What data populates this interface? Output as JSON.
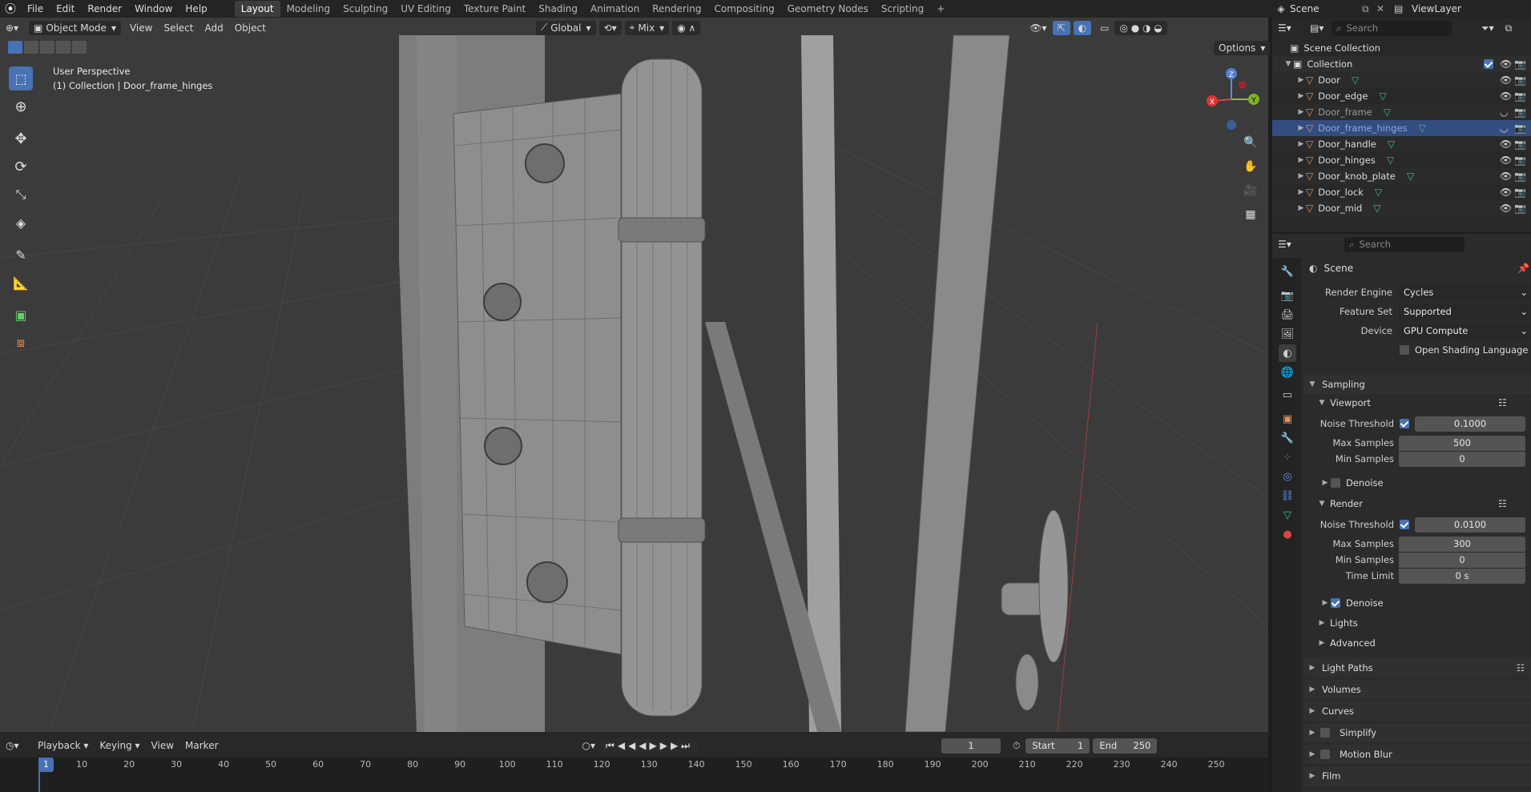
{
  "topbar": {
    "menus": [
      "File",
      "Edit",
      "Render",
      "Window",
      "Help"
    ],
    "workspaces": [
      "Layout",
      "Modeling",
      "Sculpting",
      "UV Editing",
      "Texture Paint",
      "Shading",
      "Animation",
      "Rendering",
      "Compositing",
      "Geometry Nodes",
      "Scripting"
    ],
    "active_workspace": "Layout",
    "add_tab": "+",
    "scene": "Scene",
    "view_layer": "ViewLayer"
  },
  "viewport": {
    "mode": "Object Mode",
    "menus": [
      "View",
      "Select",
      "Add",
      "Object"
    ],
    "orientation": "Global",
    "snap_mode": "Mix",
    "options": "Options",
    "info_line1": "User Perspective",
    "info_line2": "(1) Collection | Door_frame_hinges",
    "gizmo": {
      "x": "X",
      "y": "Y",
      "z": "Z"
    }
  },
  "timeline": {
    "menus": [
      "Playback",
      "Keying",
      "View",
      "Marker"
    ],
    "current_frame": "1",
    "start_label": "Start",
    "start": "1",
    "end_label": "End",
    "end": "250",
    "ruler": [
      "1",
      "10",
      "20",
      "30",
      "40",
      "50",
      "60",
      "70",
      "80",
      "90",
      "100",
      "110",
      "120",
      "130",
      "140",
      "150",
      "160",
      "170",
      "180",
      "190",
      "200",
      "210",
      "220",
      "230",
      "240",
      "250"
    ]
  },
  "outliner": {
    "search_placeholder": "Search",
    "scene_collection": "Scene Collection",
    "collection": "Collection",
    "objects": [
      "Door",
      "Door_edge",
      "Door_frame",
      "Door_frame_hinges",
      "Door_handle",
      "Door_hinges",
      "Door_knob_plate",
      "Door_lock",
      "Door_mid"
    ],
    "selected": "Door_frame_hinges"
  },
  "properties": {
    "search_placeholder": "Search",
    "context": "Scene",
    "render_engine_label": "Render Engine",
    "render_engine": "Cycles",
    "feature_set_label": "Feature Set",
    "feature_set": "Supported",
    "device_label": "Device",
    "device": "GPU Compute",
    "osl_label": "Open Shading Language",
    "sampling": "Sampling",
    "viewport": {
      "title": "Viewport",
      "noise_threshold_label": "Noise Threshold",
      "noise_threshold": "0.1000",
      "max_samples_label": "Max Samples",
      "max_samples": "500",
      "min_samples_label": "Min Samples",
      "min_samples": "0",
      "denoise_label": "Denoise"
    },
    "render": {
      "title": "Render",
      "noise_threshold_label": "Noise Threshold",
      "noise_threshold": "0.0100",
      "max_samples_label": "Max Samples",
      "max_samples": "300",
      "min_samples_label": "Min Samples",
      "min_samples": "0",
      "time_limit_label": "Time Limit",
      "time_limit": "0 s",
      "denoise_label": "Denoise"
    },
    "lights": "Lights",
    "advanced": "Advanced",
    "panels": [
      "Light Paths",
      "Volumes",
      "Curves",
      "Simplify",
      "Motion Blur",
      "Film"
    ]
  },
  "colors": {
    "accent": "#4772b3",
    "selected_row": "#334d80",
    "object_icon": "#e8935b",
    "mesh_icon": "#3fbd8c"
  }
}
